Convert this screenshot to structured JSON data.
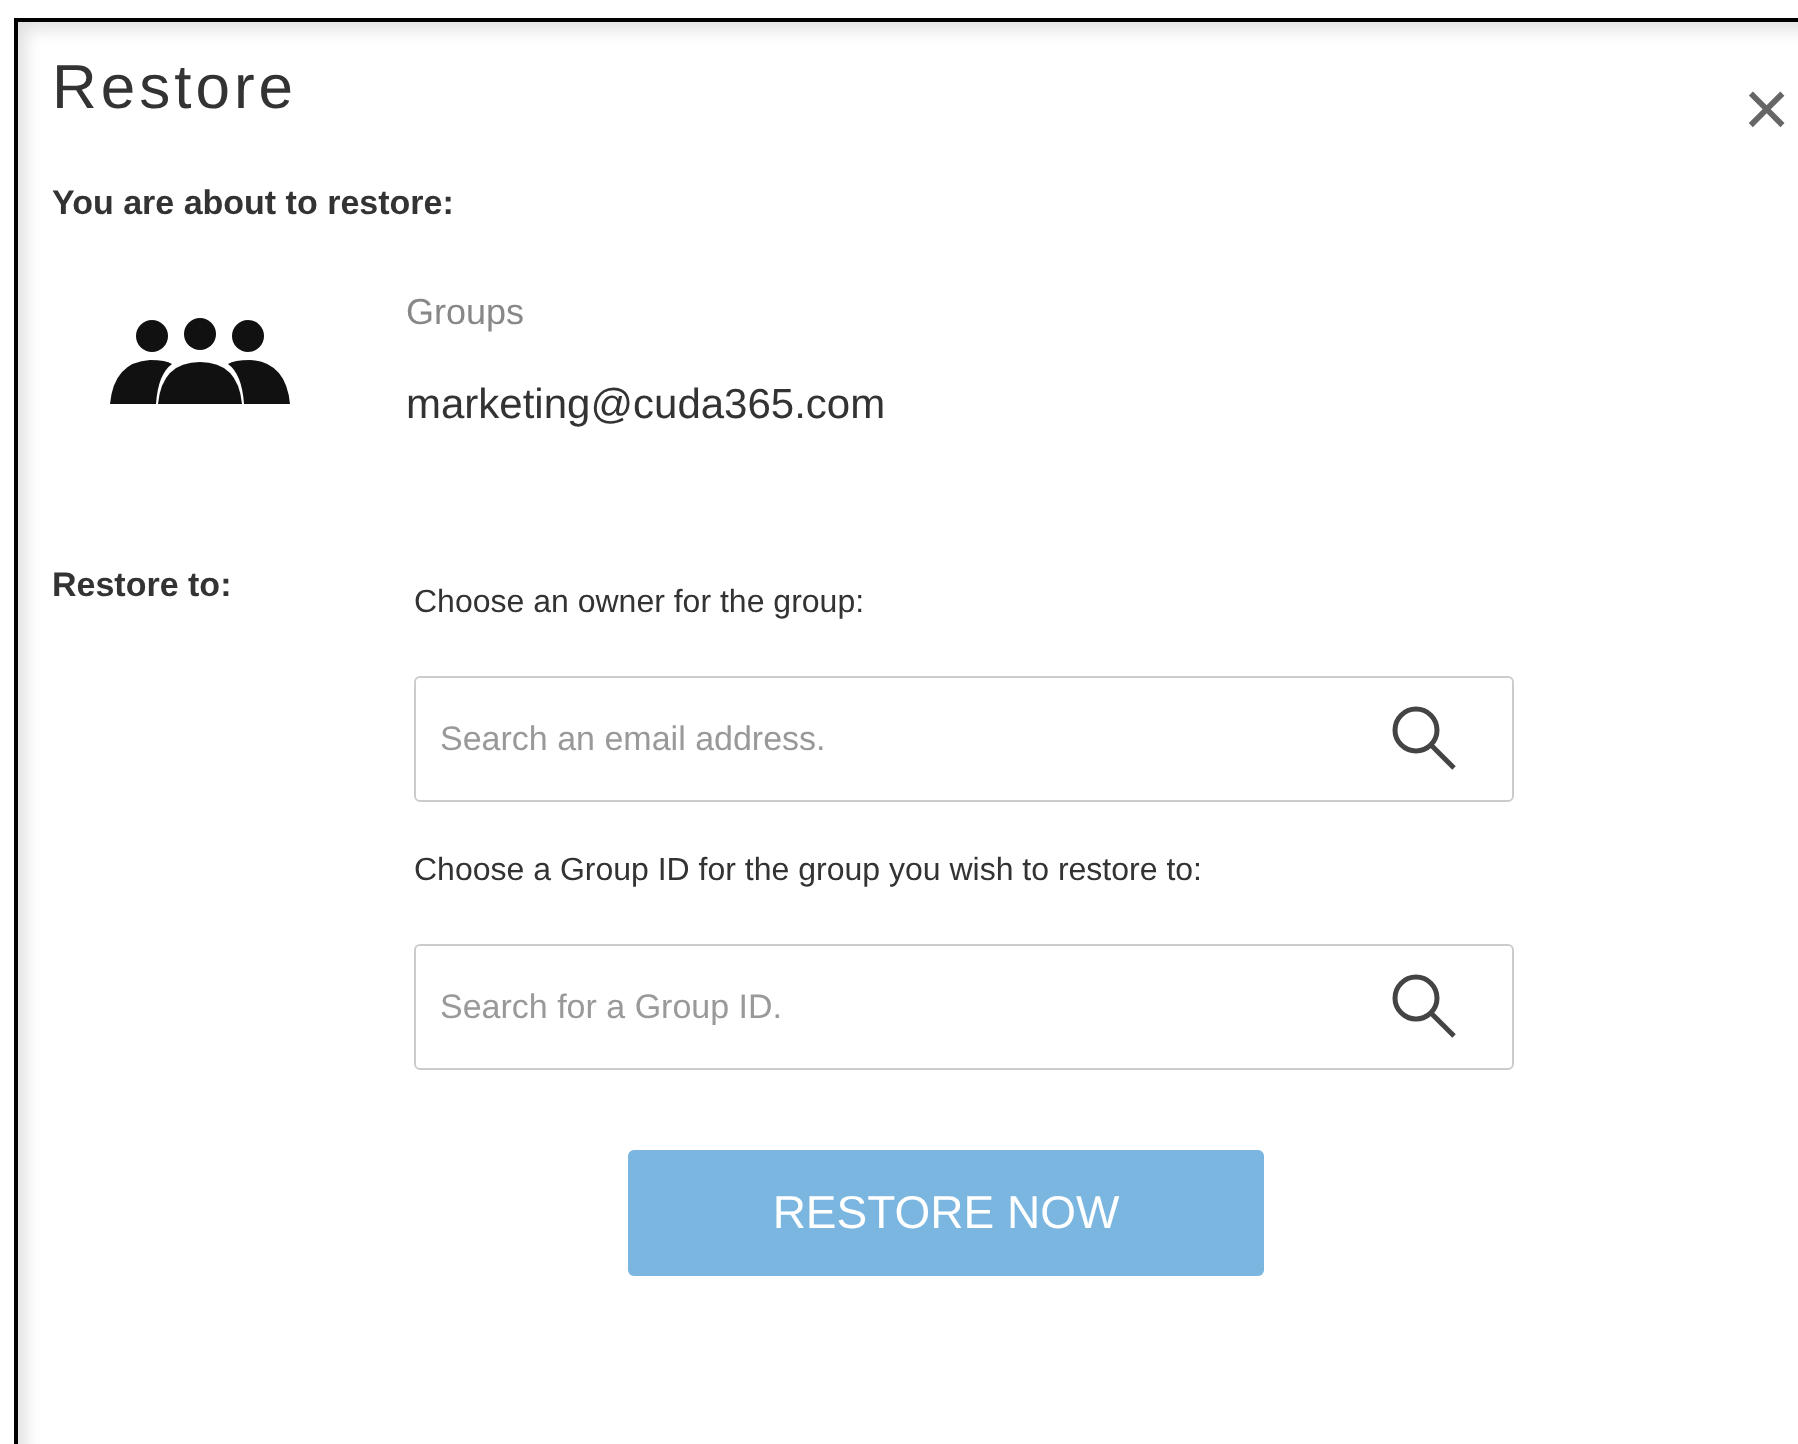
{
  "dialog": {
    "title": "Restore",
    "close": "×"
  },
  "intro": "You are about to restore:",
  "item": {
    "type": "Groups",
    "name": "marketing@cuda365.com"
  },
  "restore_to": {
    "label": "Restore to:",
    "fields": [
      {
        "label": "Choose an owner for the group:",
        "placeholder": "Search an email address."
      },
      {
        "label": "Choose a Group ID for the group you wish to restore to:",
        "placeholder": "Search for a Group ID."
      }
    ]
  },
  "button": {
    "label": "RESTORE NOW",
    "disabled": true
  }
}
